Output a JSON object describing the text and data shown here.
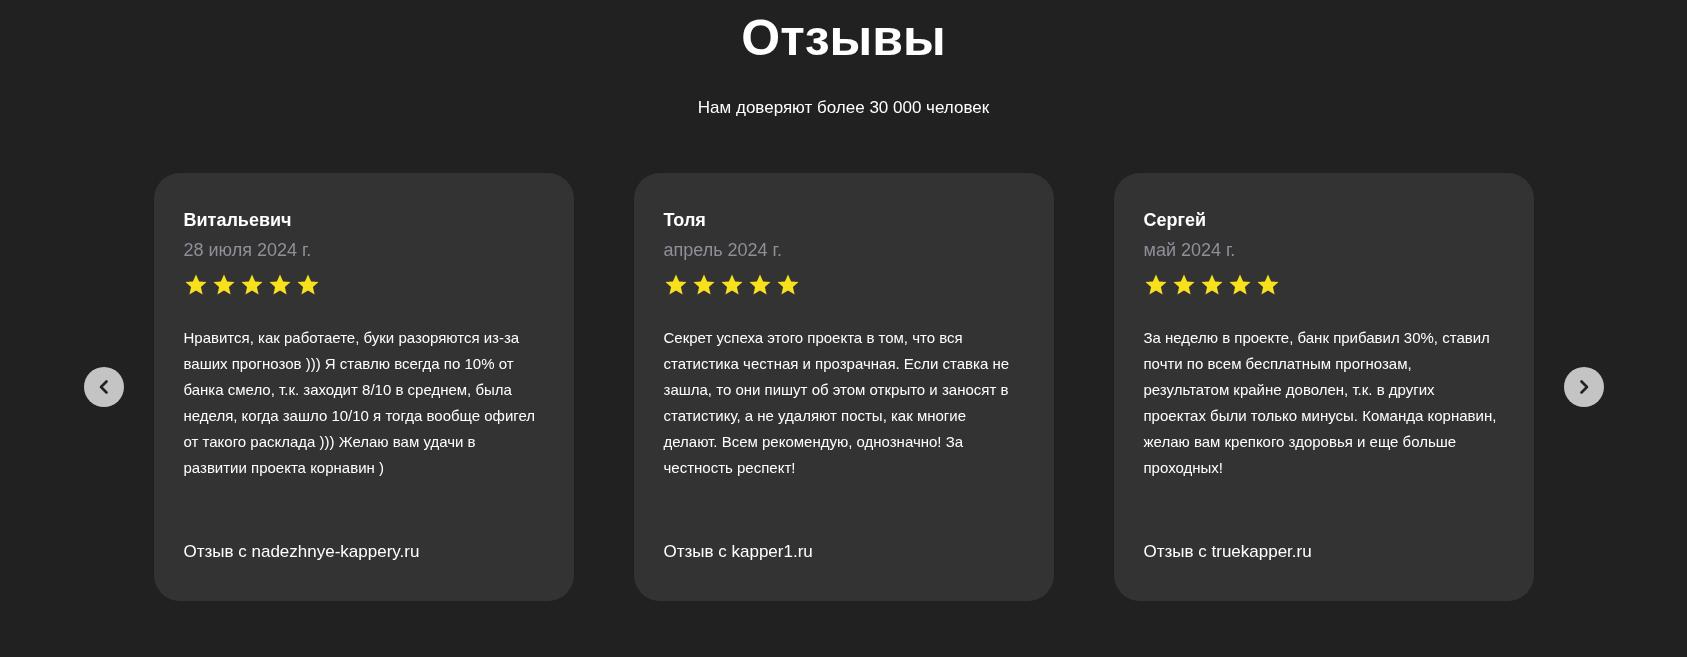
{
  "heading": "Отзывы",
  "subtitle": "Нам доверяют более 30 000 человек",
  "reviews": [
    {
      "name": "Витальевич",
      "date": "28 июля 2024 г.",
      "stars": 5,
      "text": "Нравится, как работаете, буки разоряются из-за ваших прогнозов ))) Я ставлю всегда по 10% от банка смело, т.к. заходит 8/10 в среднем, была неделя, когда зашло 10/10 я тогда вообще офигел от такого расклада ))) Желаю вам удачи в развитии проекта корнавин )",
      "source": "Отзыв с nadezhnye-kappery.ru"
    },
    {
      "name": "Толя",
      "date": "апрель 2024 г.",
      "stars": 5,
      "text": "Секрет успеха этого проекта в том, что вся статистика честная и прозрачная. Если ставка не зашла, то они пишут об этом открыто и заносят в статистику, а не удаляют посты, как многие делают. Всем рекомендую, однозначно! За честность респект!",
      "source": "Отзыв с kapper1.ru"
    },
    {
      "name": "Сергей",
      "date": "май 2024 г.",
      "stars": 5,
      "text": "За неделю в проекте, банк прибавил 30%, ставил почти по всем бесплатным прогнозам, результатом крайне доволен, т.к. в других проектах были только минусы. Команда корнавин, желаю вам крепкого здоровья и еще больше проходных!",
      "source": "Отзыв с truekapper.ru"
    }
  ]
}
